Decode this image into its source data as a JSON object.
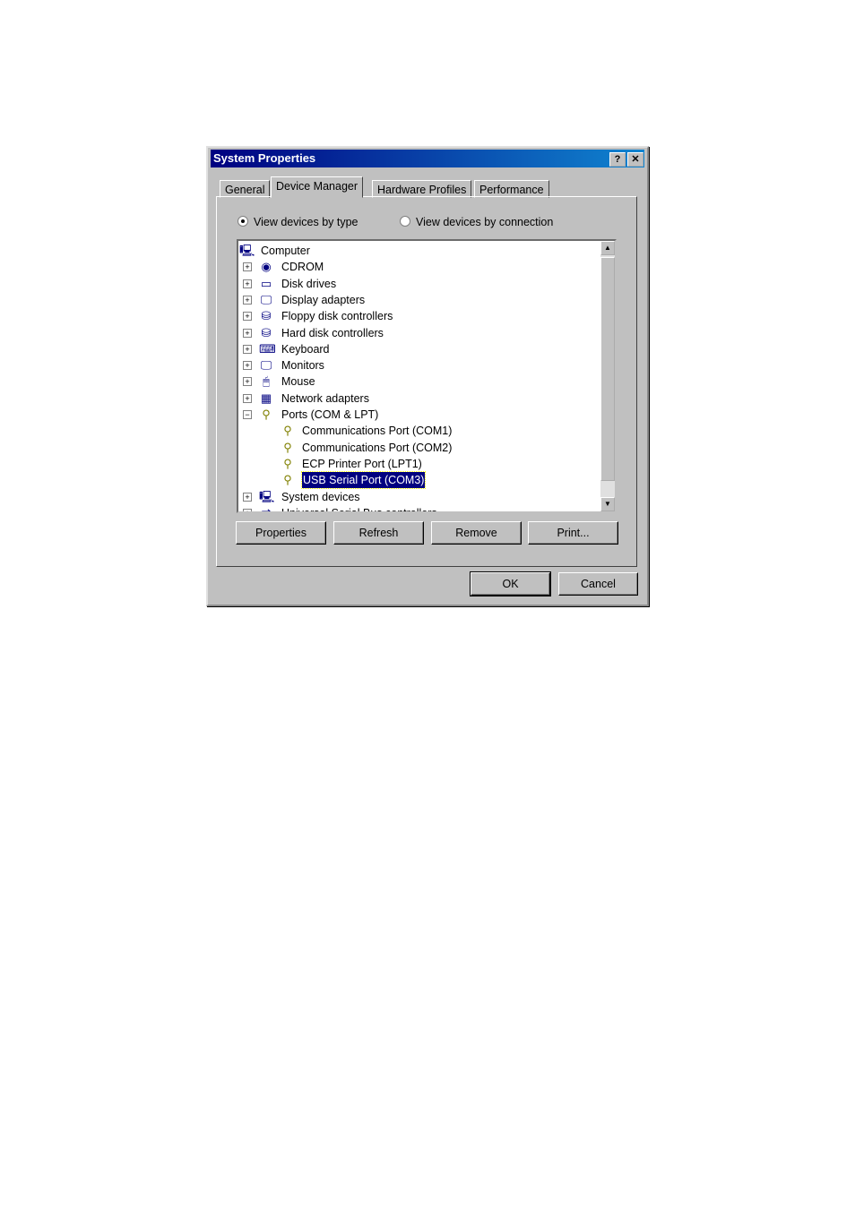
{
  "window": {
    "title": "System Properties",
    "help_label": "?",
    "close_label": "✕"
  },
  "tabs": [
    {
      "label": "General"
    },
    {
      "label": "Device Manager",
      "active": true
    },
    {
      "label": "Hardware Profiles"
    },
    {
      "label": "Performance"
    }
  ],
  "view_options": {
    "by_type": "View devices by type",
    "by_connection": "View devices by connection",
    "selected": "by_type"
  },
  "tree": [
    {
      "label": "Computer",
      "level": 0,
      "icon": "computer-icon"
    },
    {
      "label": "CDROM",
      "level": 1,
      "icon": "cdrom-icon",
      "expander": "+"
    },
    {
      "label": "Disk drives",
      "level": 1,
      "icon": "disk-drive-icon",
      "expander": "+"
    },
    {
      "label": "Display adapters",
      "level": 1,
      "icon": "display-adapter-icon",
      "expander": "+"
    },
    {
      "label": "Floppy disk controllers",
      "level": 1,
      "icon": "floppy-controller-icon",
      "expander": "+"
    },
    {
      "label": "Hard disk controllers",
      "level": 1,
      "icon": "hard-disk-controller-icon",
      "expander": "+"
    },
    {
      "label": "Keyboard",
      "level": 1,
      "icon": "keyboard-icon",
      "expander": "+"
    },
    {
      "label": "Monitors",
      "level": 1,
      "icon": "monitor-icon",
      "expander": "+"
    },
    {
      "label": "Mouse",
      "level": 1,
      "icon": "mouse-icon",
      "expander": "+"
    },
    {
      "label": "Network adapters",
      "level": 1,
      "icon": "network-adapter-icon",
      "expander": "+"
    },
    {
      "label": "Ports (COM & LPT)",
      "level": 1,
      "icon": "port-icon",
      "expander": "−"
    },
    {
      "label": "Communications Port (COM1)",
      "level": 2,
      "icon": "port-icon"
    },
    {
      "label": "Communications Port (COM2)",
      "level": 2,
      "icon": "port-icon"
    },
    {
      "label": "ECP Printer Port (LPT1)",
      "level": 2,
      "icon": "port-icon"
    },
    {
      "label": "USB Serial Port (COM3)",
      "level": 2,
      "icon": "port-icon",
      "selected": true
    },
    {
      "label": "System devices",
      "level": 1,
      "icon": "system-devices-icon",
      "expander": "+"
    },
    {
      "label": "Universal Serial Bus controllers",
      "level": 1,
      "icon": "usb-icon",
      "expander": "+"
    }
  ],
  "buttons": {
    "properties": "Properties",
    "refresh": "Refresh",
    "remove": "Remove",
    "print": "Print...",
    "ok": "OK",
    "cancel": "Cancel"
  }
}
